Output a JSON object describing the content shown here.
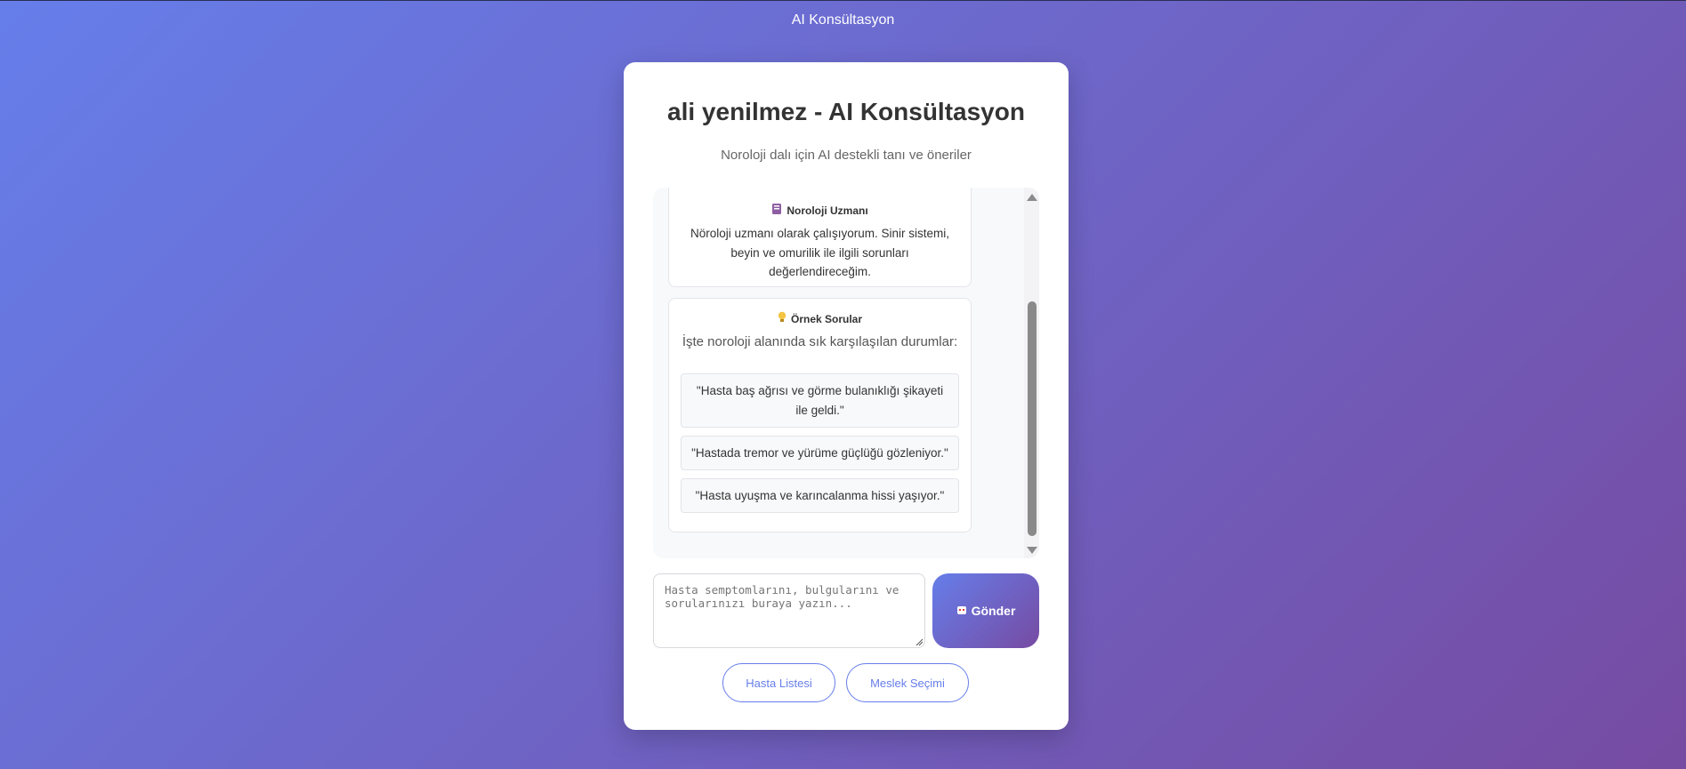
{
  "window": {
    "title": "AI Konsültasyon"
  },
  "header": {
    "title": "ali yenilmez - AI Konsültasyon",
    "subtitle": "Noroloji dalı için AI destekli tanı ve öneriler"
  },
  "chat": {
    "specialist": {
      "icon": "brain-book-icon",
      "title": "Noroloji Uzmanı",
      "text": "Nöroloji uzmanı olarak çalışıyorum. Sinir sistemi, beyin ve omurilik ile ilgili sorunları değerlendireceğim."
    },
    "examples": {
      "icon": "lightbulb-icon",
      "title": "Örnek Sorular",
      "intro": "İşte noroloji alanında sık karşılaşılan durumlar:",
      "items": [
        "\"Hasta baş ağrısı ve görme bulanıklığı şikayeti ile geldi.\"",
        "\"Hastada tremor ve yürüme güçlüğü gözleniyor.\"",
        "\"Hasta uyuşma ve karıncalanma hissi yaşıyor.\""
      ]
    }
  },
  "input": {
    "placeholder": "Hasta semptomlarını, bulgularını ve sorularınızı buraya yazın..."
  },
  "send": {
    "label": "Gönder",
    "icon": "robot-icon"
  },
  "buttons": {
    "patient_list": "Hasta Listesi",
    "profession": "Meslek Seçimi"
  },
  "colors": {
    "gradient_start": "#667eea",
    "gradient_end": "#764ba2"
  }
}
